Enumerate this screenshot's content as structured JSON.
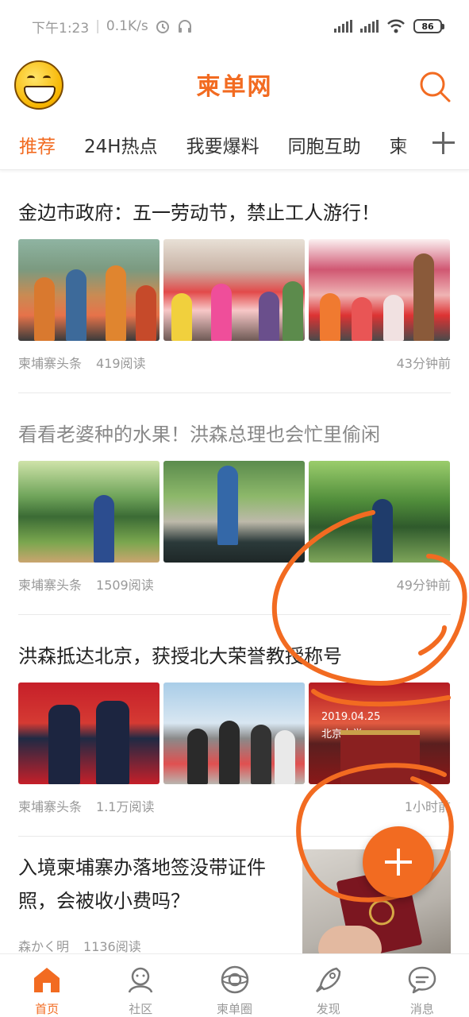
{
  "status_bar": {
    "time": "下午1:23",
    "speed": "0.1K/s",
    "battery": "86"
  },
  "header": {
    "logo_text": "柬单网",
    "avatar_icon": "smiley-avatar-icon",
    "search_icon": "search-icon"
  },
  "tabs": [
    {
      "label": "推荐",
      "active": true
    },
    {
      "label": "24H热点"
    },
    {
      "label": "我要爆料"
    },
    {
      "label": "同胞互助"
    },
    {
      "label": "柬"
    }
  ],
  "articles": [
    {
      "title": "金边市政府：五一劳动节，禁止工人游行！",
      "source": "柬埔寨头条",
      "reads": "419阅读",
      "time": "43分钟前",
      "read": false
    },
    {
      "title": "看看老婆种的水果！洪森总理也会忙里偷闲",
      "source": "柬埔寨头条",
      "reads": "1509阅读",
      "time": "49分钟前",
      "read": true
    },
    {
      "title": "洪森抵达北京，获授北大荣誉教授称号",
      "source": "柬埔寨头条",
      "reads": "1.1万阅读",
      "time": "1小时前",
      "read": false,
      "image_text_1": "2019.04.25",
      "image_text_2": "北京大学"
    },
    {
      "title": "入境柬埔寨办落地签没带证件照，会被收小费吗？",
      "source": "森かく明",
      "reads": "1136阅读"
    }
  ],
  "bottom_nav": [
    {
      "label": "首页",
      "icon": "home-icon",
      "active": true
    },
    {
      "label": "社区",
      "icon": "community-icon"
    },
    {
      "label": "柬单圈",
      "icon": "circle-icon"
    },
    {
      "label": "发现",
      "icon": "rocket-icon"
    },
    {
      "label": "消息",
      "icon": "message-icon"
    }
  ],
  "colors": {
    "accent": "#f26b21",
    "scribble": "#f26b21"
  }
}
